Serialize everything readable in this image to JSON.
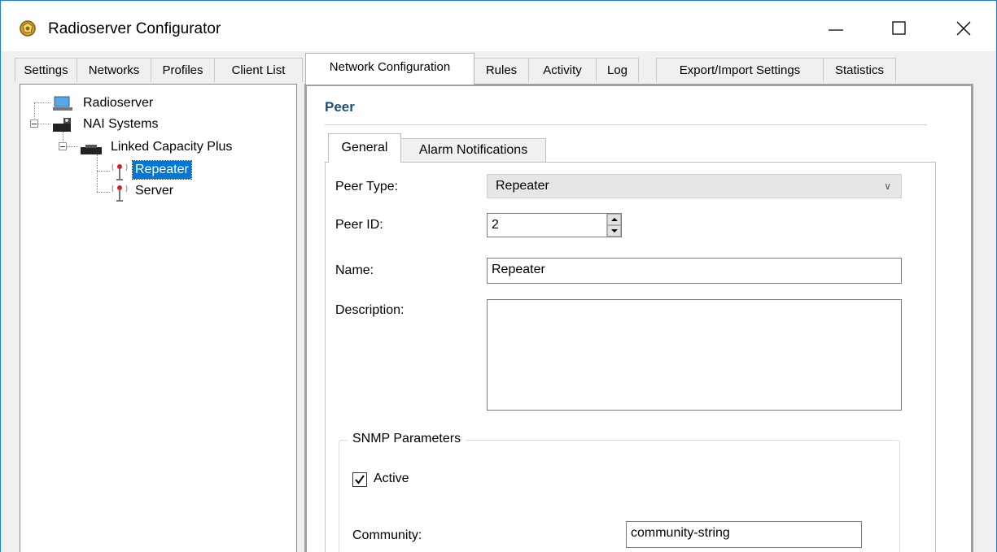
{
  "window": {
    "title": "Radioserver Configurator"
  },
  "tabs": [
    {
      "label": "Settings"
    },
    {
      "label": "Networks"
    },
    {
      "label": "Profiles"
    },
    {
      "label": "Client List"
    },
    {
      "label": "Network Configuration"
    },
    {
      "label": "Rules"
    },
    {
      "label": "Activity"
    },
    {
      "label": "Log"
    },
    {
      "label": "Export/Import Settings"
    },
    {
      "label": "Statistics"
    }
  ],
  "active_tab": "Network Configuration",
  "tree": {
    "items": [
      {
        "label": "Radioserver",
        "icon": "computer-icon"
      },
      {
        "label": "NAI Systems",
        "icon": "network-icon"
      },
      {
        "label": "Linked Capacity Plus",
        "icon": "network-device-icon"
      },
      {
        "label": "Repeater",
        "icon": "antenna-icon",
        "selected": true
      },
      {
        "label": "Server",
        "icon": "antenna-icon"
      }
    ]
  },
  "peer": {
    "title": "Peer",
    "subtabs": [
      {
        "label": "General"
      },
      {
        "label": "Alarm Notifications"
      }
    ],
    "peer_type_label": "Peer Type:",
    "peer_type_value": "Repeater",
    "peer_id_label": "Peer ID:",
    "peer_id_value": "2",
    "name_label": "Name:",
    "name_value": "Repeater",
    "description_label": "Description:",
    "description_value": "",
    "snmp": {
      "title": "SNMP Parameters",
      "active_label": "Active",
      "active_checked": true,
      "community_label": "Community:",
      "community_value": "community-string"
    }
  }
}
